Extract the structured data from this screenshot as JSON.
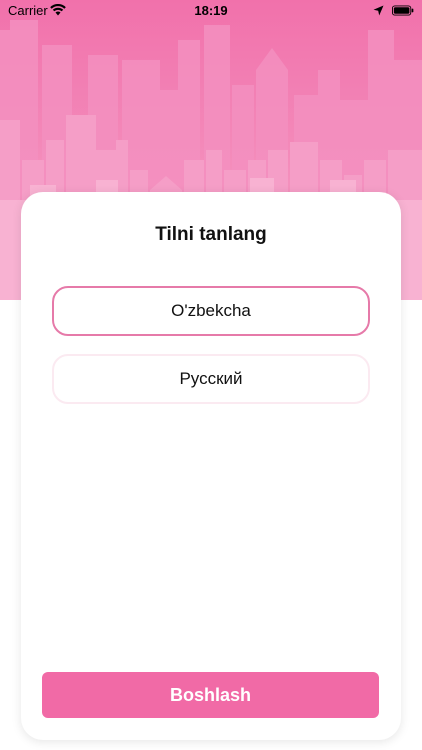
{
  "status_bar": {
    "carrier": "Carrier",
    "time": "18:19",
    "icons": [
      "wifi-icon",
      "location-icon",
      "battery-icon"
    ]
  },
  "header": {
    "background_color": "#f171ab",
    "illustration": "city-skyline"
  },
  "card": {
    "title": "Tilni tanlang",
    "options": [
      {
        "label": "O'zbekcha",
        "selected": true
      },
      {
        "label": "Русский",
        "selected": false
      }
    ],
    "start_button_label": "Boshlash"
  },
  "colors": {
    "accent": "#f16aa6",
    "selected_border": "#e67aa9",
    "unselected_border": "#fbeaf1"
  }
}
